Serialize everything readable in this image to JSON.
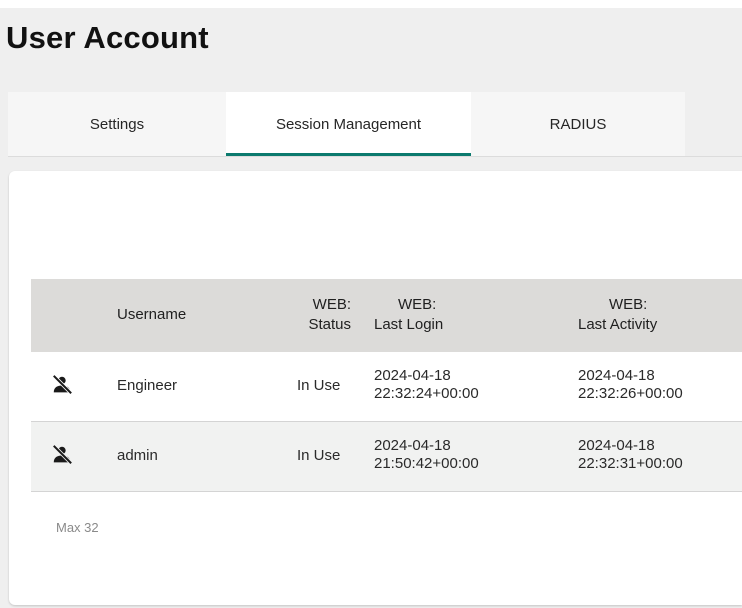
{
  "page": {
    "title": "User Account"
  },
  "tabs": [
    {
      "label": "Settings",
      "active": false
    },
    {
      "label": "Session Management",
      "active": true
    },
    {
      "label": "RADIUS",
      "active": false
    }
  ],
  "table": {
    "columns": [
      {
        "key": "username",
        "lines": [
          "Username"
        ]
      },
      {
        "key": "web_status",
        "lines": [
          "WEB:",
          "Status"
        ]
      },
      {
        "key": "web_last_login",
        "lines": [
          "WEB:",
          "Last Login"
        ]
      },
      {
        "key": "web_last_activity",
        "lines": [
          "WEB:",
          "Last Activity"
        ]
      }
    ],
    "rows": [
      {
        "icon": "logout-user-icon",
        "username": "Engineer",
        "web_status": "In Use",
        "web_last_login": [
          "2024-04-18",
          "22:32:24+00:00"
        ],
        "web_last_activity": [
          "2024-04-18",
          "22:32:26+00:00"
        ]
      },
      {
        "icon": "logout-user-icon",
        "username": "admin",
        "web_status": "In Use",
        "web_last_login": [
          "2024-04-18",
          "21:50:42+00:00"
        ],
        "web_last_activity": [
          "2024-04-18",
          "22:32:31+00:00"
        ]
      }
    ]
  },
  "footer": {
    "max_note": "Max 32"
  },
  "colors": {
    "accent": "#0c7a6e",
    "header_bg": "#dcdbd9",
    "page_bg": "#efefef"
  }
}
